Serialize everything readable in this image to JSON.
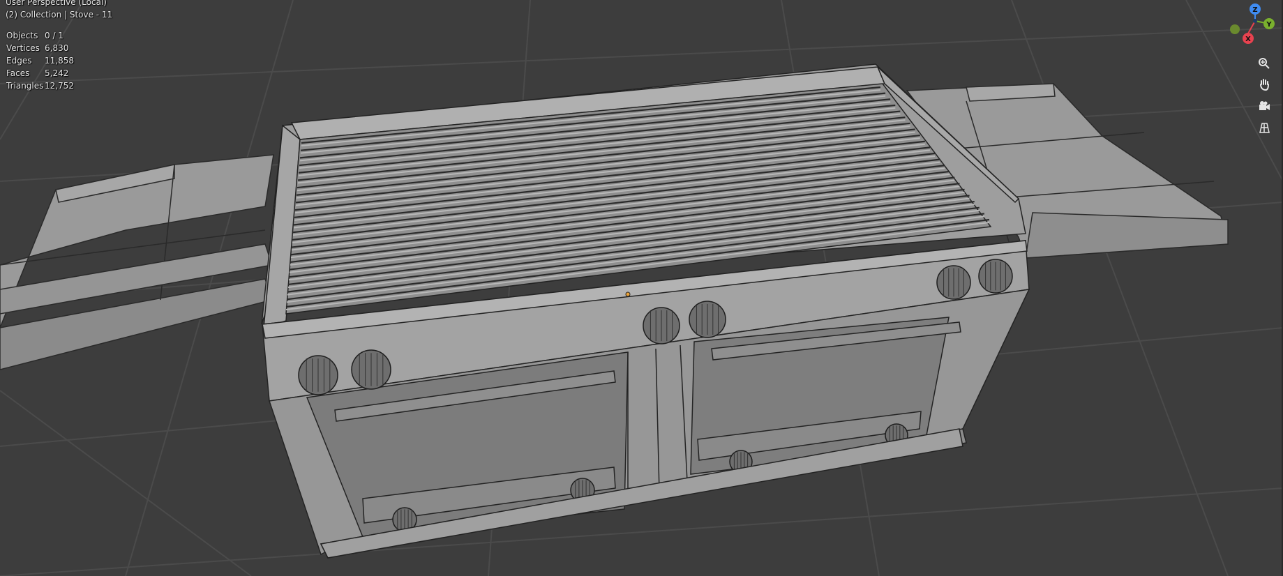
{
  "viewport": {
    "view_name": "User Perspective (Local)",
    "collection_line": "(2) Collection | Stove - 11"
  },
  "stats": [
    {
      "label": "Objects",
      "value": "0 / 1"
    },
    {
      "label": "Vertices",
      "value": "6,830"
    },
    {
      "label": "Edges",
      "value": "11,858"
    },
    {
      "label": "Faces",
      "value": "5,242"
    },
    {
      "label": "Triangles",
      "value": "12,752"
    }
  ],
  "gizmo": {
    "z_label": "Z",
    "y_label": "Y",
    "x_label": "X",
    "colors": {
      "x": "#e8424f",
      "y": "#7ab02e",
      "z": "#3f8cf2"
    }
  },
  "nav_buttons": [
    {
      "name": "zoom",
      "icon": "zoom-icon"
    },
    {
      "name": "pan",
      "icon": "hand-icon"
    },
    {
      "name": "camera",
      "icon": "camera-icon"
    },
    {
      "name": "ortho",
      "icon": "grid-icon"
    }
  ],
  "theme": {
    "background": "#3d3d3d",
    "grid_line": "#4a4a4a",
    "mesh_face": "#9c9c9c",
    "mesh_edge": "#222222"
  }
}
